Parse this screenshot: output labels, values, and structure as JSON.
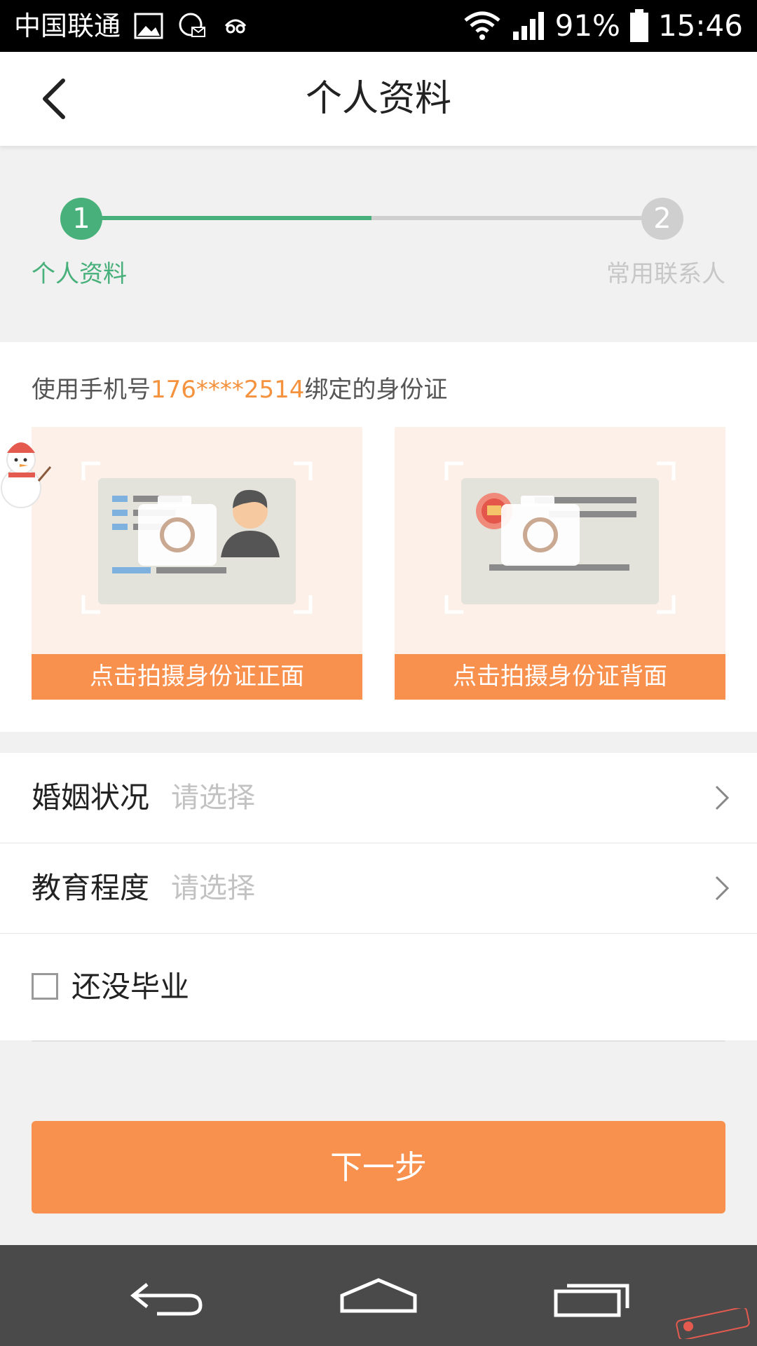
{
  "status_bar": {
    "carrier": "中国联通",
    "battery": "91%",
    "time": "15:46"
  },
  "header": {
    "title": "个人资料"
  },
  "stepper": {
    "step1_number": "1",
    "step1_label": "个人资料",
    "step2_number": "2",
    "step2_label": "常用联系人"
  },
  "id_section": {
    "hint_prefix": "使用手机号",
    "hint_phone": "176****2514",
    "hint_suffix": "绑定的身份证",
    "front_button": "点击拍摄身份证正面",
    "back_button": "点击拍摄身份证背面"
  },
  "form": {
    "marriage_label": "婚姻状况",
    "marriage_placeholder": "请选择",
    "education_label": "教育程度",
    "education_placeholder": "请选择",
    "not_graduated_label": "还没毕业"
  },
  "actions": {
    "next_label": "下一步"
  },
  "colors": {
    "accent_orange": "#f8904e",
    "step_green": "#48b07a",
    "phone_highlight": "#f5923e"
  }
}
